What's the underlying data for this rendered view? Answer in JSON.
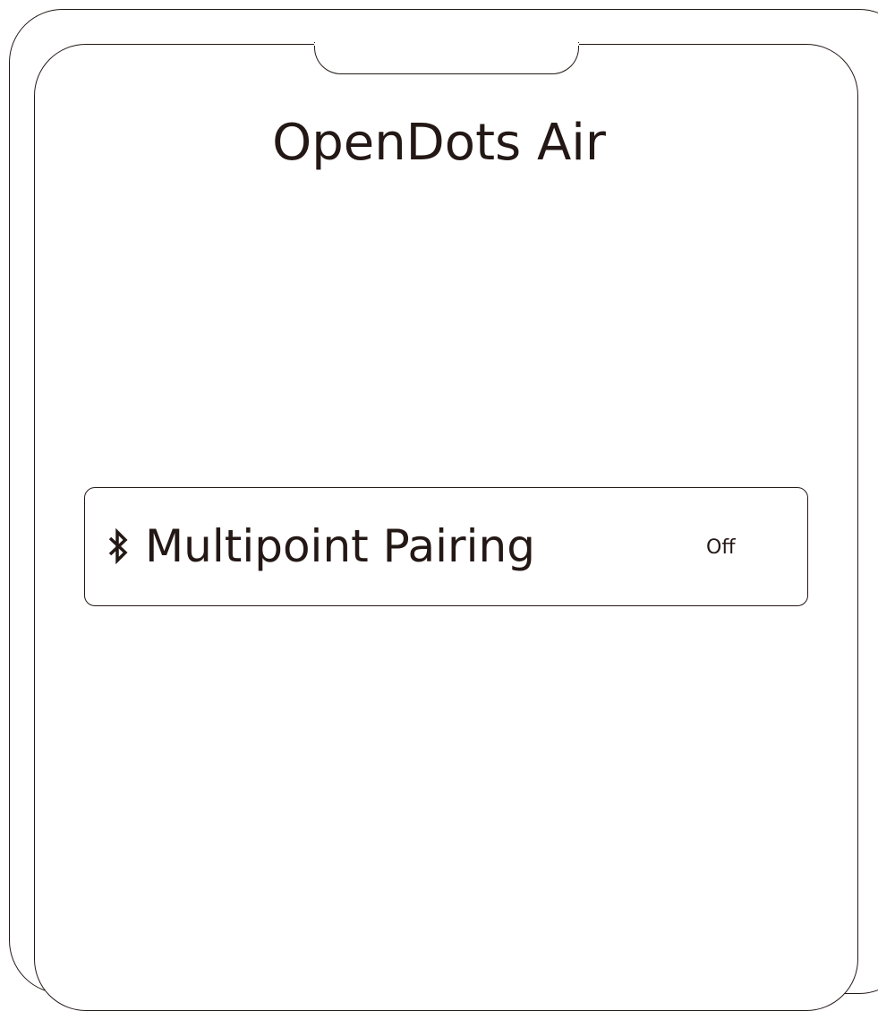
{
  "app": {
    "title": "OpenDots Air"
  },
  "settings": {
    "items": [
      {
        "icon": "bluetooth-icon",
        "label": "Multipoint Pairing",
        "value": "Off"
      }
    ]
  },
  "colors": {
    "foreground": "#231815",
    "background": "#ffffff"
  }
}
